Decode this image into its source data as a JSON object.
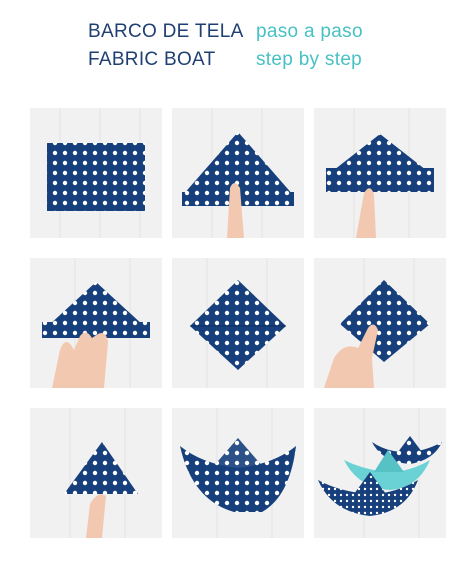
{
  "title": {
    "spanish_main": "BARCO DE TELA",
    "spanish_sub": "paso a paso",
    "english_main": "FABRIC BOAT",
    "english_sub": "step by step"
  },
  "colors": {
    "title_dark": "#1f3f73",
    "title_light": "#48c1c4",
    "fabric_blue": "#163f7c",
    "dot_white": "#ffffff",
    "turquoise_boat": "#6ad2d5",
    "skin": "#f2c9b0"
  },
  "steps": [
    {
      "icon": "flat-fabric-rectangle-icon"
    },
    {
      "icon": "fold-triangle-hat-icon"
    },
    {
      "icon": "folded-hat-icon"
    },
    {
      "icon": "hat-with-hand-icon"
    },
    {
      "icon": "square-diamond-icon"
    },
    {
      "icon": "diamond-fold-icon"
    },
    {
      "icon": "triangle-fold-icon"
    },
    {
      "icon": "finished-boat-icon"
    },
    {
      "icon": "boats-group-icon"
    }
  ]
}
